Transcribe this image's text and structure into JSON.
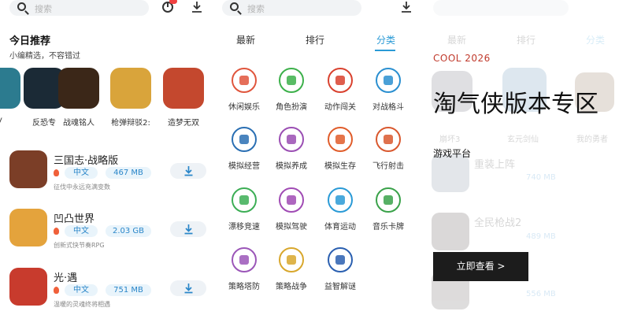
{
  "panel1": {
    "search_placeholder": "搜索",
    "section_title": "今日推荐",
    "section_subtitle": "小编精选，不容错过",
    "recommended": [
      {
        "label": "y",
        "color": "#2c7b8f"
      },
      {
        "label": "反恐专",
        "color": "#1b2a36"
      },
      {
        "label": "战魂铭人",
        "color": "#3b2718"
      },
      {
        "label": "枪弹辩驳2:",
        "color": "#d9a43b"
      },
      {
        "label": "造梦无双",
        "color": "#c4482e"
      }
    ],
    "games": [
      {
        "name": "三国志·战略版",
        "lang": "中文",
        "size": "467 MB",
        "desc": "征伐中永远充满变数",
        "color": "#7b3e27"
      },
      {
        "name": "凹凸世界",
        "lang": "中文",
        "size": "2.03 GB",
        "desc": "创新式快节奏RPG",
        "color": "#e4a33c"
      },
      {
        "name": "光·遇",
        "lang": "中文",
        "size": "751 MB",
        "desc": "温暖的灵魂终将相遇",
        "color": "#c83b2d"
      }
    ]
  },
  "panel2": {
    "search_placeholder": "搜索",
    "tabs": [
      "最新",
      "排行",
      "分类"
    ],
    "categories": [
      {
        "label": "休闲娱乐",
        "color": "#e0553c"
      },
      {
        "label": "角色扮演",
        "color": "#3cb04a"
      },
      {
        "label": "动作闯关",
        "color": "#d9412e"
      },
      {
        "label": "对战格斗",
        "color": "#2a8fd0"
      },
      {
        "label": "模拟经营",
        "color": "#2a6fb3"
      },
      {
        "label": "模拟养成",
        "color": "#9a4eb3"
      },
      {
        "label": "模拟生存",
        "color": "#e05c2a"
      },
      {
        "label": "飞行射击",
        "color": "#d9582e"
      },
      {
        "label": "漂移竞速",
        "color": "#3cae55"
      },
      {
        "label": "模拟驾驶",
        "color": "#a04bb4"
      },
      {
        "label": "体育运动",
        "color": "#2a9ad6"
      },
      {
        "label": "音乐卡牌",
        "color": "#3aa24a"
      },
      {
        "label": "策略塔防",
        "color": "#9b56b8"
      },
      {
        "label": "策略战争",
        "color": "#d8a72c"
      },
      {
        "label": "益智解谜",
        "color": "#2a5fb0"
      }
    ]
  },
  "panel3": {
    "brand": "COOL 2026",
    "title": "淘气侠版本专区",
    "subtitle": "游戏平台",
    "cta_label": "立即查看 >",
    "ghost_tabs": [
      "最新",
      "排行",
      "分类"
    ],
    "ghost_items": [
      "崩坏3",
      "玄元剑仙",
      "我的勇者"
    ],
    "ghost_games": [
      {
        "name": "重装上阵",
        "size": "740 MB"
      },
      {
        "name": "全民枪战2",
        "size": "489 MB"
      },
      {
        "name": "",
        "size": "556 MB"
      }
    ]
  }
}
